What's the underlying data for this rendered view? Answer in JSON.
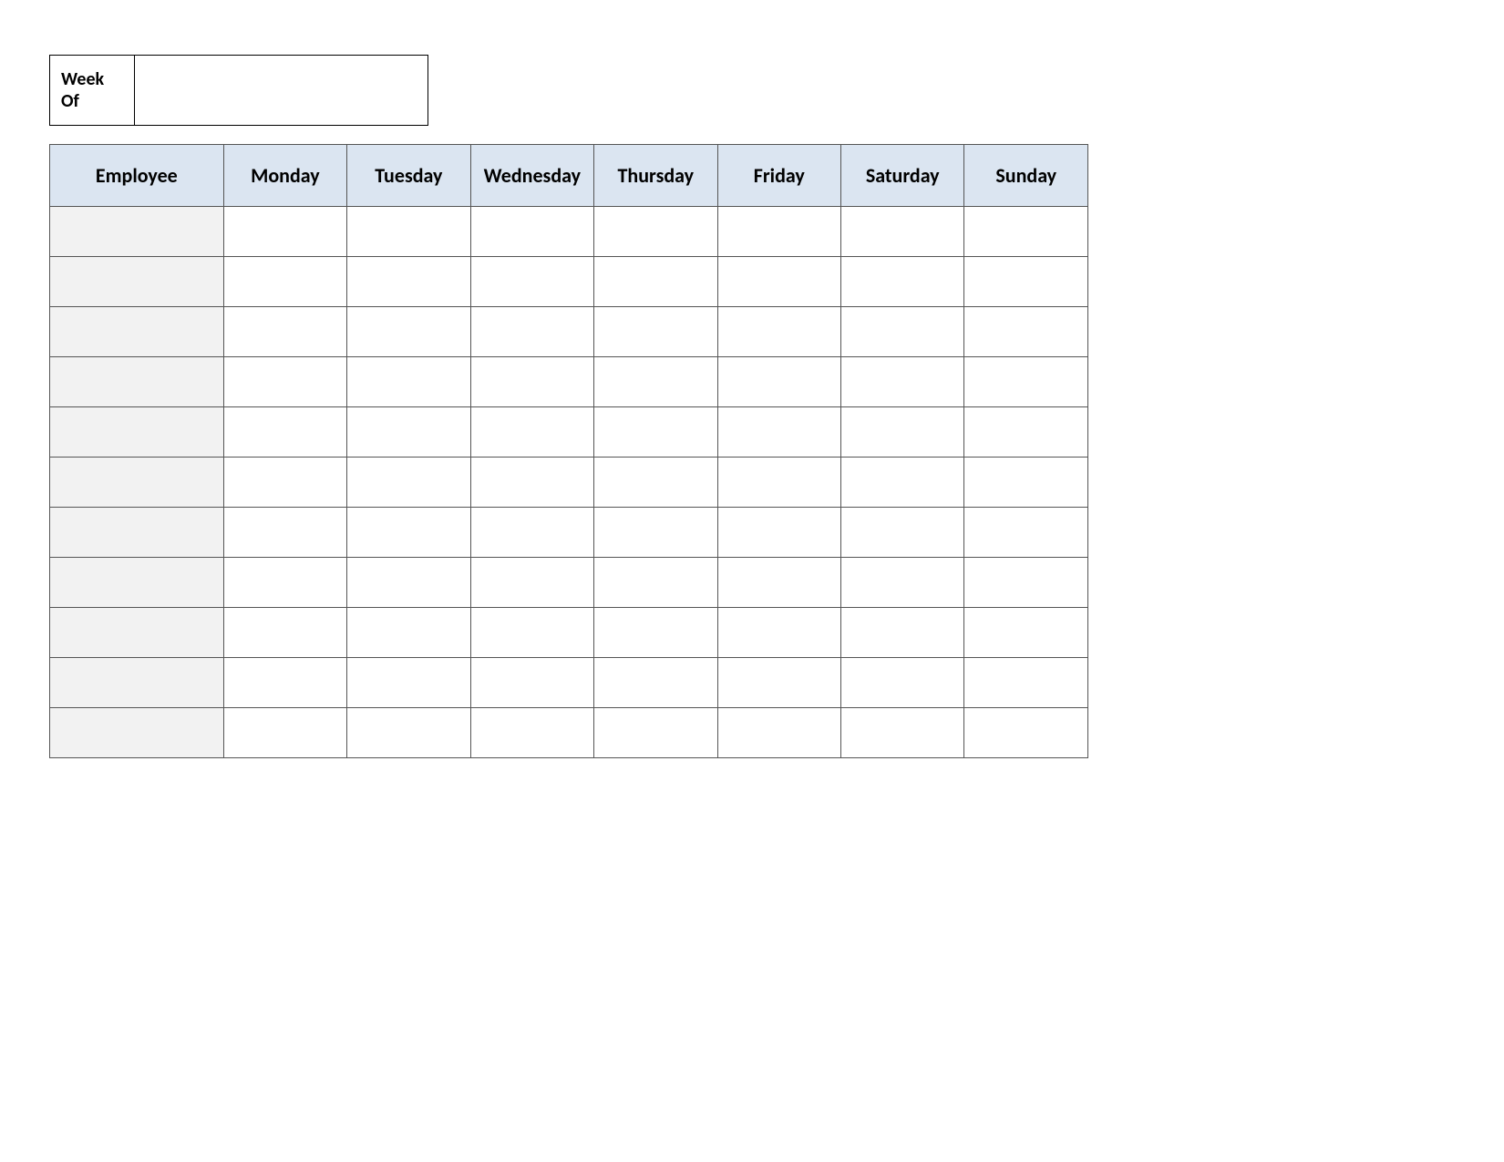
{
  "header": {
    "week_of_label": "Week Of",
    "week_of_value": ""
  },
  "table": {
    "columns": [
      "Employee",
      "Monday",
      "Tuesday",
      "Wednesday",
      "Thursday",
      "Friday",
      "Saturday",
      "Sunday"
    ],
    "rows": [
      {
        "employee": "",
        "mon": "",
        "tue": "",
        "wed": "",
        "thu": "",
        "fri": "",
        "sat": "",
        "sun": ""
      },
      {
        "employee": "",
        "mon": "",
        "tue": "",
        "wed": "",
        "thu": "",
        "fri": "",
        "sat": "",
        "sun": ""
      },
      {
        "employee": "",
        "mon": "",
        "tue": "",
        "wed": "",
        "thu": "",
        "fri": "",
        "sat": "",
        "sun": ""
      },
      {
        "employee": "",
        "mon": "",
        "tue": "",
        "wed": "",
        "thu": "",
        "fri": "",
        "sat": "",
        "sun": ""
      },
      {
        "employee": "",
        "mon": "",
        "tue": "",
        "wed": "",
        "thu": "",
        "fri": "",
        "sat": "",
        "sun": ""
      },
      {
        "employee": "",
        "mon": "",
        "tue": "",
        "wed": "",
        "thu": "",
        "fri": "",
        "sat": "",
        "sun": ""
      },
      {
        "employee": "",
        "mon": "",
        "tue": "",
        "wed": "",
        "thu": "",
        "fri": "",
        "sat": "",
        "sun": ""
      },
      {
        "employee": "",
        "mon": "",
        "tue": "",
        "wed": "",
        "thu": "",
        "fri": "",
        "sat": "",
        "sun": ""
      },
      {
        "employee": "",
        "mon": "",
        "tue": "",
        "wed": "",
        "thu": "",
        "fri": "",
        "sat": "",
        "sun": ""
      },
      {
        "employee": "",
        "mon": "",
        "tue": "",
        "wed": "",
        "thu": "",
        "fri": "",
        "sat": "",
        "sun": ""
      },
      {
        "employee": "",
        "mon": "",
        "tue": "",
        "wed": "",
        "thu": "",
        "fri": "",
        "sat": "",
        "sun": ""
      }
    ]
  }
}
